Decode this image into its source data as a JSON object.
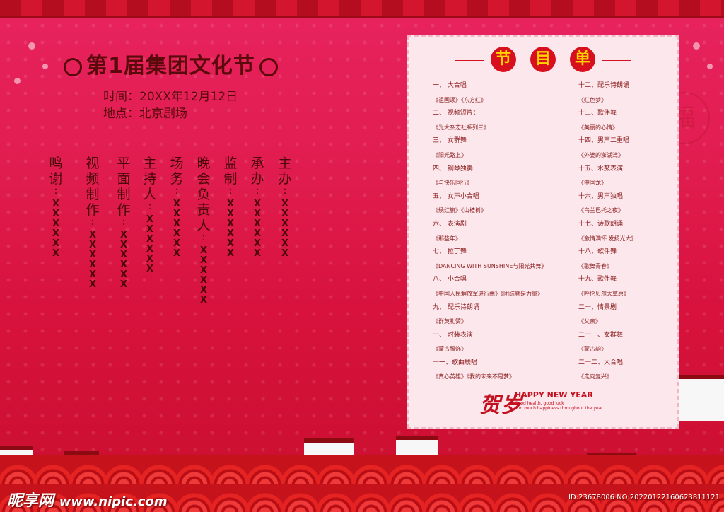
{
  "event": {
    "title": "第1届集团文化节",
    "time": "时间：20XX年12月12日",
    "place": "地点：北京剧场"
  },
  "staff": [
    {
      "role": "主办",
      "name": "XXXXXX"
    },
    {
      "role": "承办",
      "name": "XXXXXX"
    },
    {
      "role": "监制",
      "name": "XXXXXX"
    },
    {
      "role": "晚会负责人",
      "name": "XXXXXX"
    },
    {
      "role": "场务",
      "name": "XXXXXX"
    },
    {
      "role": "主持人",
      "name": "XXXXXX"
    },
    {
      "role": "平面制作",
      "name": "XXXXXX"
    },
    {
      "role": "视频制作",
      "name": "XXXXXX"
    },
    {
      "role": "鸣谢",
      "name": "XXXXXX"
    }
  ],
  "program": {
    "title_chars": [
      "节",
      "目",
      "单"
    ],
    "left_items": [
      "一、 大合唱",
      "《祖国颂》《东方红》",
      "二、 视频短片：",
      "《光大杂志社系列三》",
      "三、 女群舞",
      "《阳光路上》",
      "四、 钢琴独奏",
      "《与快乐同行》",
      "五、 女声小合唱",
      "《绣红旗》《山楂树》",
      "六、 表演剧",
      "《那些年》",
      "七、 拉丁舞",
      "《DANCING WITH SUNSHINE与阳光共舞》",
      "八、 小合唱",
      "《中国人民解放军进行曲》《团结就是力量》",
      "九、 配乐诗朗诵",
      "《群英礼赞》",
      "十、 时装表演",
      "《蒙古服饰》",
      "十一、歌曲联唱",
      "《真心英雄》《我的未来不是梦》"
    ],
    "right_items": [
      "十二、配乐诗朗诵",
      "《红色梦》",
      "十三、歌伴舞",
      "《美丽的心情》",
      "十四、男声二重唱",
      "《外婆的澎湖湾》",
      "十五、水鼓表演",
      "《中国龙》",
      "十六、男声独唱",
      "《乌兰巴托之夜》",
      "十七、诗歌朗诵",
      "《激情满怀 发扬光大》",
      "十八、歌伴舞",
      "《歌舞青春》",
      "十九、歌伴舞",
      "《呼伦贝尔大草原》",
      "二十、情景剧",
      "《父亲》",
      "二十一、女群舞",
      "《蒙古韵》",
      "二十二、大合唱",
      "《走向复兴》"
    ]
  },
  "greeting": {
    "he_sui": "贺岁",
    "headline": "HAPPY NEW YEAR",
    "line1": "Good health,    good luck",
    "line2": "and much happiness throughout the year"
  },
  "decor": {
    "fu": "福"
  },
  "watermark": {
    "brand": "昵享网",
    "url": "www.nipic.com",
    "id_text": "ID:23678006 NO:20220122160623811121"
  }
}
